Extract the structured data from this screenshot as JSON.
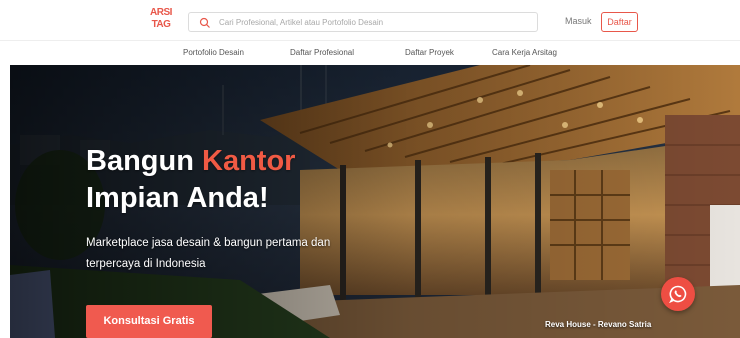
{
  "brand": {
    "logo_line1": "ARSI",
    "logo_line2": "TAG",
    "accent_color": "#f05a44"
  },
  "header": {
    "search_placeholder": "Cari Profesional, Artikel atau Portofolio Desain",
    "login_label": "Masuk",
    "register_label": "Daftar"
  },
  "nav": {
    "items": [
      {
        "label": "Portofolio Desain"
      },
      {
        "label": "Daftar Profesional"
      },
      {
        "label": "Daftar Proyek"
      },
      {
        "label": "Cara Kerja Arsitag"
      }
    ]
  },
  "hero": {
    "title_part1": "Bangun ",
    "title_accent": "Kantor",
    "title_line2": "Impian Anda!",
    "subtitle_line1": "Marketplace jasa desain & bangun pertama dan",
    "subtitle_line2": "terpercaya di Indonesia",
    "cta_label": "Konsultasi Gratis",
    "photo_caption": "Reva House - Revano Satria"
  },
  "icons": {
    "search": "search-icon",
    "chat": "whatsapp-icon"
  }
}
